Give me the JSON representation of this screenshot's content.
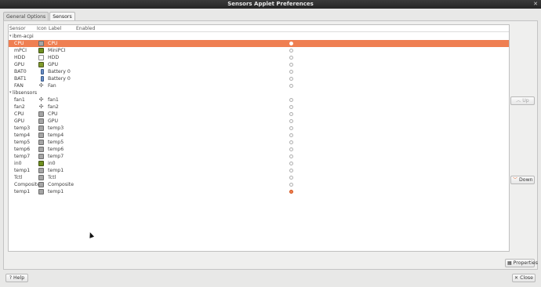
{
  "window": {
    "title": "Sensors Applet Preferences",
    "close_glyph": "✕"
  },
  "tabs": [
    {
      "label": "General Options",
      "active": false
    },
    {
      "label": "Sensors",
      "active": true
    }
  ],
  "columns": {
    "sensor": "Sensor",
    "icon": "Icon",
    "label": "Label",
    "enabled": "Enabled"
  },
  "groups": [
    {
      "name": "ibm-acpi",
      "rows": [
        {
          "sensor": "CPU",
          "icon": "cpu-icon",
          "label": "CPU",
          "enabled": true,
          "selected": true
        },
        {
          "sensor": "mPCI",
          "icon": "minipci-icon",
          "label": "MiniPCI",
          "enabled": false
        },
        {
          "sensor": "HDD",
          "icon": "hdd-icon",
          "label": "HDD",
          "enabled": false
        },
        {
          "sensor": "GPU",
          "icon": "gpu-icon",
          "label": "GPU",
          "enabled": false
        },
        {
          "sensor": "BAT0",
          "icon": "battery-icon",
          "label": "Battery 0",
          "enabled": false
        },
        {
          "sensor": "BAT1",
          "icon": "battery-icon",
          "label": "Battery 0",
          "enabled": false
        },
        {
          "sensor": "FAN",
          "icon": "fan-icon",
          "label": "Fan",
          "enabled": false
        }
      ]
    },
    {
      "name": "libsensors",
      "rows": [
        {
          "sensor": "fan1",
          "icon": "fan-icon",
          "label": "fan1",
          "enabled": false
        },
        {
          "sensor": "fan2",
          "icon": "fan-icon",
          "label": "fan2",
          "enabled": false
        },
        {
          "sensor": "CPU",
          "icon": "cpu-icon",
          "label": "CPU",
          "enabled": false
        },
        {
          "sensor": "GPU",
          "icon": "cpu-icon",
          "label": "GPU",
          "enabled": false
        },
        {
          "sensor": "temp3",
          "icon": "cpu-icon",
          "label": "temp3",
          "enabled": false
        },
        {
          "sensor": "temp4",
          "icon": "cpu-icon",
          "label": "temp4",
          "enabled": false
        },
        {
          "sensor": "temp5",
          "icon": "cpu-icon",
          "label": "temp5",
          "enabled": false
        },
        {
          "sensor": "temp6",
          "icon": "cpu-icon",
          "label": "temp6",
          "enabled": false
        },
        {
          "sensor": "temp7",
          "icon": "cpu-icon",
          "label": "temp7",
          "enabled": false
        },
        {
          "sensor": "in0",
          "icon": "voltage-icon",
          "label": "in0",
          "enabled": false
        },
        {
          "sensor": "temp1",
          "icon": "cpu-icon",
          "label": "temp1",
          "enabled": false
        },
        {
          "sensor": "Tctl",
          "icon": "cpu-icon",
          "label": "Tctl",
          "enabled": false
        },
        {
          "sensor": "Composite",
          "icon": "cpu-icon",
          "label": "Composite",
          "enabled": false
        },
        {
          "sensor": "temp1",
          "icon": "cpu-icon",
          "label": "temp1",
          "enabled": true
        }
      ]
    }
  ],
  "buttons": {
    "up": {
      "label": "Up",
      "icon": "chevron-up-icon",
      "enabled": false
    },
    "down": {
      "label": "Down",
      "icon": "chevron-down-icon",
      "enabled": true
    },
    "properties": {
      "label": "Properties",
      "icon": "properties-icon"
    },
    "help": {
      "label": "Help",
      "icon": "help-icon"
    },
    "close": {
      "label": "Close",
      "icon": "close-icon"
    }
  },
  "colors": {
    "accent": "#ef7f52",
    "selection_text": "#ffffff"
  }
}
